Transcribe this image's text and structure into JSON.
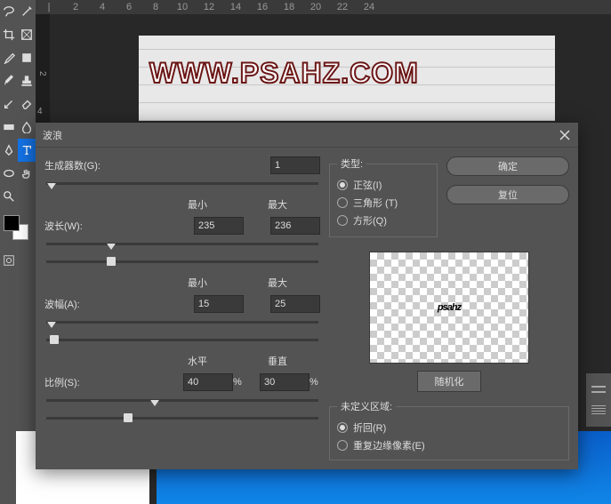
{
  "ruler_marks": [
    "2",
    "4",
    "6",
    "8",
    "10",
    "12",
    "14",
    "16",
    "18",
    "20",
    "22",
    "24"
  ],
  "ruler_v": [
    "2",
    "4"
  ],
  "watermark": "WWW.PSAHZ.COM",
  "dialog": {
    "title": "波浪",
    "gen_label": "生成器数(G):",
    "gen_value": "1",
    "min_label": "最小",
    "max_label": "最大",
    "wave_len_label": "波长(W):",
    "wave_len_min": "235",
    "wave_len_max": "236",
    "amp_label": "波幅(A):",
    "amp_min": "15",
    "amp_max": "25",
    "horiz_label": "水平",
    "vert_label": "垂直",
    "scale_label": "比例(S):",
    "scale_h": "40",
    "scale_v": "30",
    "pct": "%",
    "type_legend": "类型:",
    "type_sine": "正弦(I)",
    "type_tri": "三角形 (T)",
    "type_square": "方形(Q)",
    "ok": "确定",
    "reset": "复位",
    "randomize": "随机化",
    "undef_legend": "未定义区域:",
    "undef_wrap": "折回(R)",
    "undef_repeat": "重复边缘像素(E)",
    "preview_text": "psahz"
  }
}
